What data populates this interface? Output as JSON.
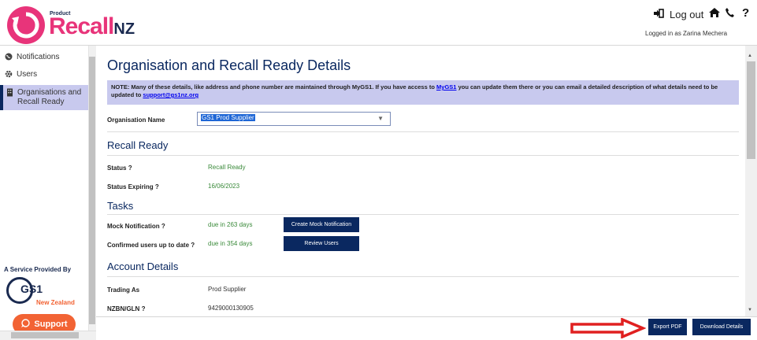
{
  "header": {
    "logo_product": "Product",
    "logo_main": "Recall",
    "logo_suffix": "NZ",
    "logout_label": "Log out",
    "logged_in_text": "Logged in as Zarina Mechera",
    "help_icon_label": "?"
  },
  "sidebar": {
    "items": [
      {
        "label": "Notifications",
        "icon": "globe-icon"
      },
      {
        "label": "Users",
        "icon": "gear-icon"
      },
      {
        "label": "Organisations and Recall Ready",
        "icon": "building-icon"
      }
    ],
    "service_label": "A Service Provided By",
    "gs1_label": "GS1",
    "gs1_region": "New Zealand",
    "support_label": "Support"
  },
  "main": {
    "title": "Organisation and Recall Ready Details",
    "note_text_1": "NOTE: Many of these details, like address and phone number are maintained through MyGS1. If you have access to",
    "note_link_1": "MyGS1",
    "note_text_2": "you can update them there or you can email a detailed description of what details need to be updated to",
    "note_link_2": "support@gs1nz.org",
    "org_name_label": "Organisation Name",
    "org_name_value": "GS1 Prod Supplier",
    "recall_ready_heading": "Recall Ready",
    "status_label": "Status",
    "status_value": "Recall Ready",
    "status_expiring_label": "Status Expiring",
    "status_expiring_value": "16/06/2023",
    "tasks_heading": "Tasks",
    "mock_notification_label": "Mock Notification",
    "mock_notification_value": "due in 263 days",
    "create_mock_button": "Create Mock Notification",
    "confirmed_users_label": "Confirmed users up to date",
    "confirmed_users_value": "due in 354 days",
    "review_users_button": "Review Users",
    "account_heading": "Account Details",
    "trading_as_label": "Trading As",
    "trading_as_value": "Prod Supplier",
    "nzbn_label": "NZBN/GLN",
    "nzbn_value": "9429000130905",
    "help_mark": "?"
  },
  "footer": {
    "export_pdf_button": "Export PDF",
    "download_button": "Download Details"
  },
  "colors": {
    "brand_pink": "#e8347a",
    "navy": "#0a2860",
    "note_bg": "#c8c9ee",
    "status_green": "#3a8a3a",
    "support_orange": "#f26334",
    "arrow_red": "#e02020"
  }
}
